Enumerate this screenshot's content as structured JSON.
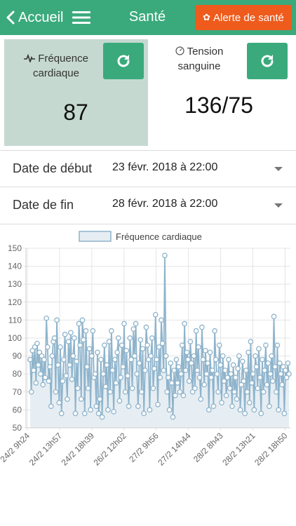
{
  "header": {
    "back_label": "Accueil",
    "title": "Santé",
    "alert_label": "Alerte de santé"
  },
  "cards": {
    "heart": {
      "label_line1": "Fréquence",
      "label_line2": "cardiaque",
      "value": "87"
    },
    "blood_pressure": {
      "label_line1": "Tension",
      "label_line2": "sanguine",
      "value": "136/75"
    }
  },
  "filters": {
    "start": {
      "label": "Date de début",
      "value": "23 févr. 2018 à 22:00"
    },
    "end": {
      "label": "Date de fin",
      "value": "28 févr. 2018 à 22:00"
    }
  },
  "colors": {
    "header": "#3aaa7c",
    "alert": "#ee5b1c",
    "card_heart_bg": "#c5d9d1",
    "series_line": "#8fb4cc",
    "series_fill": "#e6eef3"
  },
  "chart_data": {
    "type": "line",
    "legend": [
      "Fréquence cardiaque"
    ],
    "ylim": [
      50,
      150
    ],
    "yticks": [
      "150",
      "140",
      "130",
      "120",
      "110",
      "100",
      "90",
      "80",
      "70",
      "60",
      "50"
    ],
    "xticks": [
      "24/2 9h24",
      "24/2 13h57",
      "24/2 18h39",
      "26/2 12h02",
      "27/2 9h56",
      "27/2 14h44",
      "28/2 8h43",
      "28/2 13h21",
      "28/2 18h50"
    ],
    "grid": true,
    "series": [
      {
        "name": "Fréquence cardiaque",
        "values": [
          88,
          70,
          93,
          82,
          95,
          75,
          97,
          85,
          92,
          80,
          90,
          74,
          88,
          78,
          111,
          95,
          76,
          84,
          62,
          90,
          98,
          100,
          70,
          110,
          85,
          64,
          95,
          58,
          76,
          88,
          102,
          79,
          66,
          98,
          85,
          103,
          77,
          90,
          100,
          58,
          87,
          72,
          108,
          96,
          66,
          110,
          99,
          58,
          104,
          84,
          72,
          94,
          60,
          90,
          104,
          78,
          80,
          62,
          92,
          58,
          66,
          88,
          56,
          80,
          96,
          73,
          85,
          60,
          98,
          70,
          104,
          82,
          59,
          88,
          75,
          92,
          100,
          65,
          78,
          96,
          84,
          108,
          70,
          93,
          79,
          62,
          100,
          88,
          72,
          105,
          90,
          108,
          80,
          62,
          86,
          99,
          70,
          94,
          58,
          82,
          106,
          96,
          88,
          60,
          90,
          100,
          72,
          83,
          113,
          88,
          63,
          95,
          78,
          110,
          97,
          82,
          146,
          90,
          70,
          78,
          60,
          86,
          75,
          56,
          82,
          68,
          88,
          75,
          84,
          70,
          80,
          96,
          68,
          108,
          82,
          92,
          88,
          76,
          98,
          86,
          70,
          90,
          72,
          104,
          82,
          95,
          78,
          66,
          106,
          88,
          74,
          93,
          80,
          86,
          60,
          92,
          78,
          82,
          62,
          104,
          88,
          80,
          70,
          96,
          85,
          64,
          90,
          76,
          82,
          68,
          78,
          88,
          72,
          80,
          62,
          85,
          70,
          78,
          66,
          83,
          90,
          60,
          74,
          87,
          76,
          58,
          82,
          70,
          92,
          64,
          98,
          75,
          80,
          60,
          90,
          84,
          72,
          94,
          78,
          58,
          88,
          70,
          82,
          96,
          74,
          86,
          62,
          80,
          90,
          76,
          112,
          84,
          70,
          96,
          60,
          86,
          80,
          74,
          84,
          58,
          82,
          78,
          86,
          80
        ]
      }
    ]
  }
}
